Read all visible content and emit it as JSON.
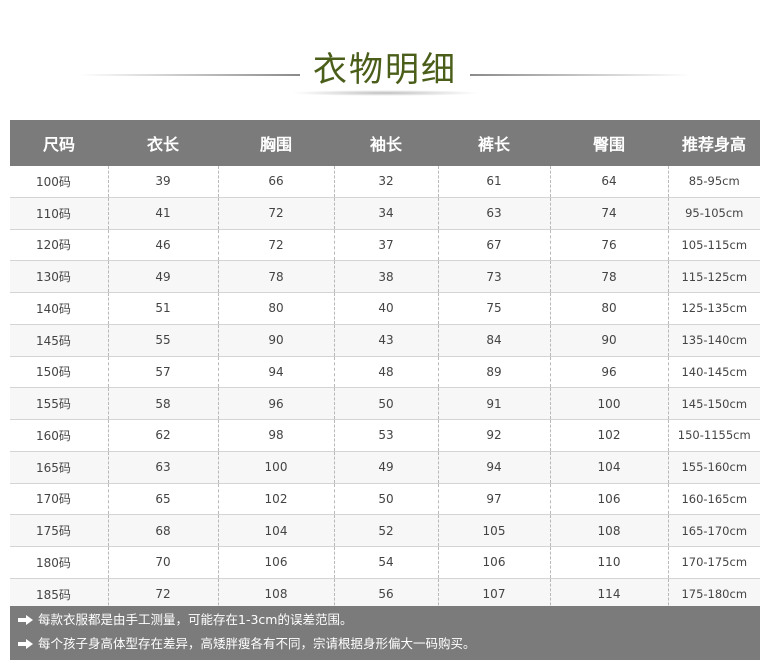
{
  "title": "衣物明细",
  "table": {
    "headers": [
      "尺码",
      "衣长",
      "胸围",
      "袖长",
      "裤长",
      "臀围",
      "推荐身高"
    ],
    "rows": [
      [
        "100码",
        "39",
        "66",
        "32",
        "61",
        "64",
        "85-95cm"
      ],
      [
        "110码",
        "41",
        "72",
        "34",
        "63",
        "74",
        "95-105cm"
      ],
      [
        "120码",
        "46",
        "72",
        "37",
        "67",
        "76",
        "105-115cm"
      ],
      [
        "130码",
        "49",
        "78",
        "38",
        "73",
        "78",
        "115-125cm"
      ],
      [
        "140码",
        "51",
        "80",
        "40",
        "75",
        "80",
        "125-135cm"
      ],
      [
        "145码",
        "55",
        "90",
        "43",
        "84",
        "90",
        "135-140cm"
      ],
      [
        "150码",
        "57",
        "94",
        "48",
        "89",
        "96",
        "140-145cm"
      ],
      [
        "155码",
        "58",
        "96",
        "50",
        "91",
        "100",
        "145-150cm"
      ],
      [
        "160码",
        "62",
        "98",
        "53",
        "92",
        "102",
        "150-1155cm"
      ],
      [
        "165码",
        "63",
        "100",
        "49",
        "94",
        "104",
        "155-160cm"
      ],
      [
        "170码",
        "65",
        "102",
        "50",
        "97",
        "106",
        "160-165cm"
      ],
      [
        "175码",
        "68",
        "104",
        "52",
        "105",
        "108",
        "165-170cm"
      ],
      [
        "180码",
        "70",
        "106",
        "54",
        "106",
        "110",
        "170-175cm"
      ],
      [
        "185码",
        "72",
        "108",
        "56",
        "107",
        "114",
        "175-180cm"
      ]
    ]
  },
  "notes": [
    "每款衣服都是由手工测量，可能存在1-3cm的误差范围。",
    "每个孩子身高体型存在差异，高矮胖瘦各有不同，宗请根据身形偏大一码购买。"
  ],
  "colors": {
    "title": "#4a5e1a",
    "header_bg": "#7b7b7b",
    "notes_bg": "#7b7b7b"
  },
  "icons": [
    "arrow-right-icon"
  ]
}
